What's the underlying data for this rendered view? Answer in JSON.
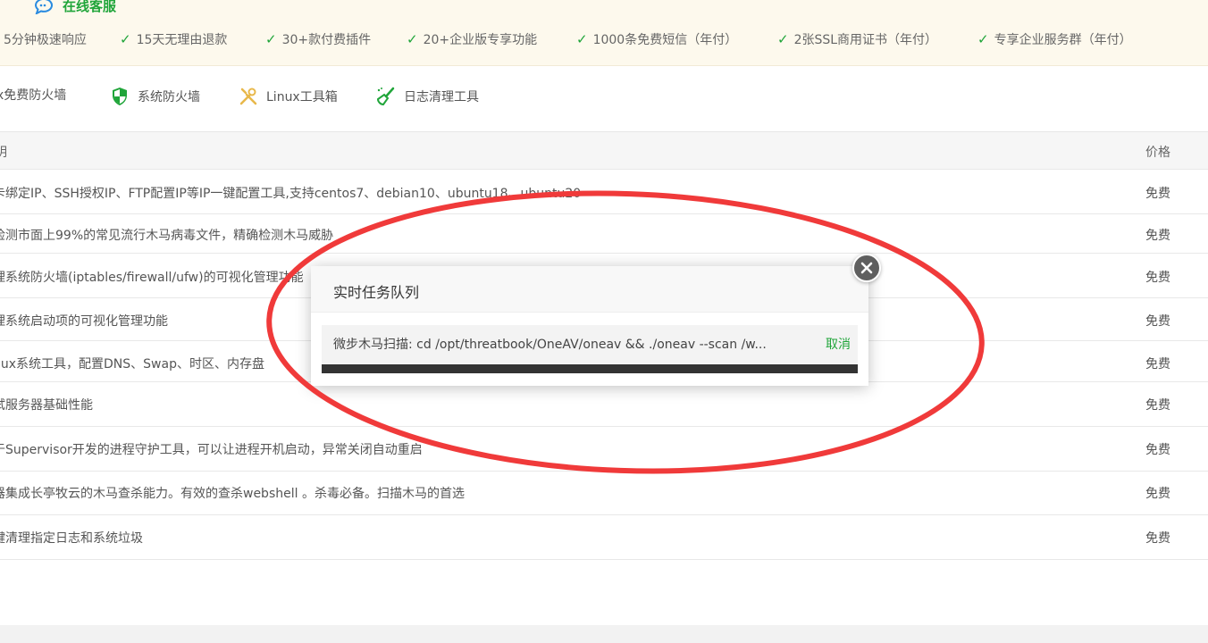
{
  "promo": {
    "title": "在线客服",
    "items": [
      "5分钟极速响应",
      "15天无理由退款",
      "30+款付费插件",
      "20+企业版专享功能",
      "1000条免费短信（年付）",
      "2张SSL商用证书（年付）",
      "专享企业服务群（年付）"
    ]
  },
  "tools": [
    {
      "label": "x免费防火墙",
      "icon": "fire-icon"
    },
    {
      "label": "系统防火墙",
      "icon": "shield-icon"
    },
    {
      "label": "Linux工具箱",
      "icon": "tools-icon"
    },
    {
      "label": "日志清理工具",
      "icon": "broom-icon"
    }
  ],
  "table": {
    "header_desc": "明",
    "header_price": "价格",
    "rows": [
      {
        "desc": "卡绑定IP、SSH授权IP、FTP配置IP等IP一键配置工具,支持centos7、debian10、ubuntu18、ubuntu20",
        "price": "免费"
      },
      {
        "desc": "检测市面上99%的常见流行木马病毒文件，精确检测木马威胁",
        "price": "免费"
      },
      {
        "desc": "理系统防火墙(iptables/firewall/ufw)的可视化管理功能",
        "price": "免费"
      },
      {
        "desc": "理系统启动项的可视化管理功能",
        "price": "免费"
      },
      {
        "desc": "nux系统工具，配置DNS、Swap、时区、内存盘",
        "price": "免费"
      },
      {
        "desc": "试服务器基础性能",
        "price": "免费"
      },
      {
        "desc": "于Supervisor开发的进程守护工具，可以让进程开机启动，异常关闭自动重启",
        "price": "免费"
      },
      {
        "desc": "器集成长亭牧云的木马查杀能力。有效的查杀webshell 。杀毒必备。扫描木马的首选",
        "price": "免费"
      },
      {
        "desc": "键清理指定日志和系统垃圾",
        "price": "免费"
      }
    ]
  },
  "dialog": {
    "title": "实时任务队列",
    "task_text": "微步木马扫描: cd /opt/threatbook/OneAV/oneav && ./oneav --scan /w...",
    "cancel_label": "取消"
  },
  "colors": {
    "accent": "#20a53a",
    "annotation": "#f03a3a"
  }
}
